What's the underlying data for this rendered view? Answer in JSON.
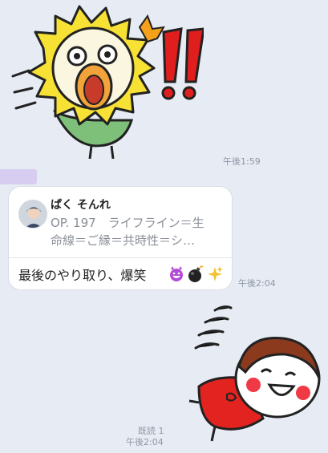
{
  "chat": {
    "messages": [
      {
        "type": "sticker",
        "sticker": "screaming-lion-sticker",
        "time": "午後1:59"
      },
      {
        "type": "reply",
        "reply_to": {
          "name": "ぱく そんれ",
          "text_line1": "OP. 197　ライフライン＝生",
          "text_line2": "命線＝ご縁＝共時性＝シ…"
        },
        "text": "最後のやり取り、爆笑",
        "emojis": [
          "devil-grin-icon",
          "bomb-icon",
          "sparkles-icon"
        ],
        "time": "午後2:04"
      },
      {
        "type": "sticker",
        "sticker": "laughing-girl-sticker",
        "read": "既読 1",
        "time": "午後2:04"
      }
    ]
  },
  "colors": {
    "background": "#e7ebf3",
    "bubble": "#ffffff",
    "timestamp": "#8f97a6"
  }
}
